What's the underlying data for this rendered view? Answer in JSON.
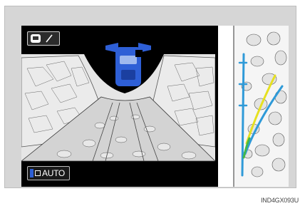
{
  "screen": {
    "auto_button": {
      "label": "AUTO"
    },
    "view_toggle": {
      "icon": "camera-switch-icon"
    },
    "car_indicator": {
      "icon": "car-front-icon",
      "color": "#2e5fd6"
    }
  },
  "guide_lines": {
    "yellow": "#e6e020",
    "blue": "#2f9ad8",
    "green": "#43b84a"
  },
  "figure_code": "IND4GX093U"
}
